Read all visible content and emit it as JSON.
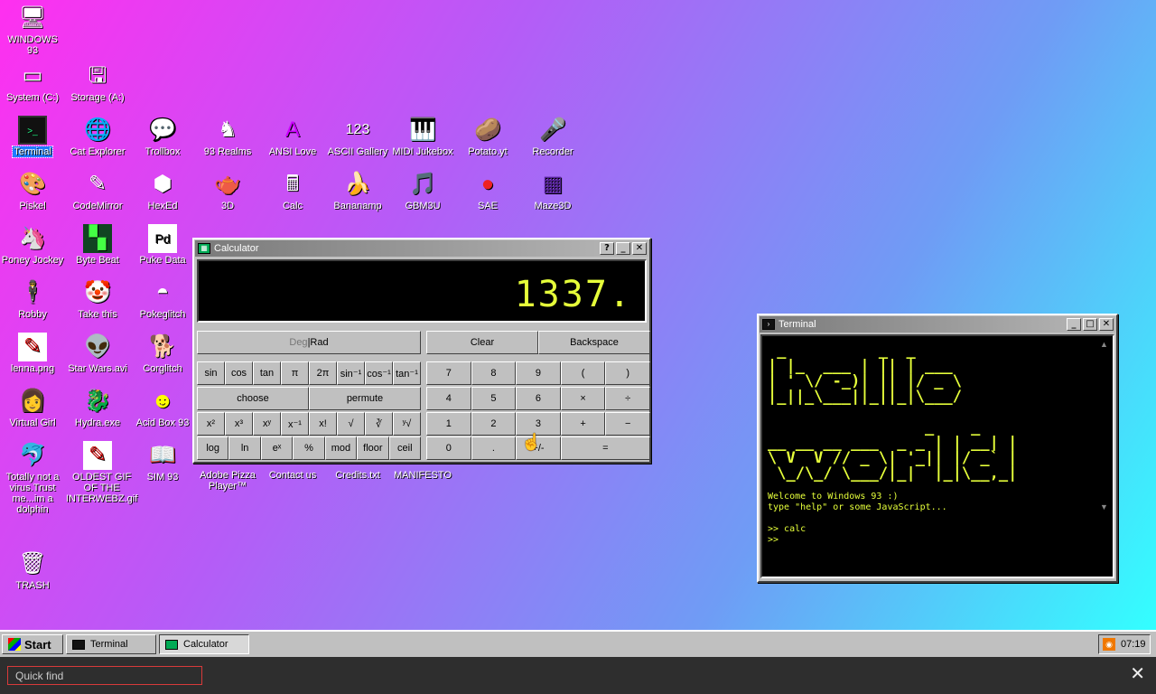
{
  "desktop": {
    "icons": [
      {
        "label": "WINDOWS 93",
        "icon": "computer-icon"
      },
      {
        "label": "System (C:)",
        "icon": "drive-icon"
      },
      {
        "label": "Storage (A:)",
        "icon": "floppy-icon"
      },
      {
        "label": "Terminal",
        "icon": "terminal-icon",
        "selected": true
      },
      {
        "label": "Cat Explorer",
        "icon": "cat-globe-icon"
      },
      {
        "label": "Trollbox",
        "icon": "chat-icon"
      },
      {
        "label": "93 Realms",
        "icon": "realms-icon"
      },
      {
        "label": "ANSI Love",
        "icon": "ansi-icon"
      },
      {
        "label": "ASCII Gallery",
        "icon": "ascii-icon"
      },
      {
        "label": "MIDI Jukebox",
        "icon": "piano-icon"
      },
      {
        "label": "Potato.yt",
        "icon": "potato-icon"
      },
      {
        "label": "Recorder",
        "icon": "microphone-icon"
      },
      {
        "label": "Piskel",
        "icon": "palette-icon"
      },
      {
        "label": "CodeMirror",
        "icon": "codemirror-icon"
      },
      {
        "label": "HexEd",
        "icon": "cube-icon"
      },
      {
        "label": "3D",
        "icon": "teapot-icon"
      },
      {
        "label": "Calc",
        "icon": "calculator-icon"
      },
      {
        "label": "Bananamp",
        "icon": "banana-icon"
      },
      {
        "label": "GBM3U",
        "icon": "music-file-icon"
      },
      {
        "label": "SAE",
        "icon": "ball-icon"
      },
      {
        "label": "Maze3D",
        "icon": "maze-icon"
      },
      {
        "label": "Poney Jockey",
        "icon": "pony-icon"
      },
      {
        "label": "Byte Beat",
        "icon": "bytebeat-icon"
      },
      {
        "label": "Puke Data",
        "icon": "puredata-icon"
      },
      {
        "label": "Robby",
        "icon": "robot-icon"
      },
      {
        "label": "Take this",
        "icon": "clown-icon"
      },
      {
        "label": "Pokeglitch",
        "icon": "pokeball-icon"
      },
      {
        "label": "lenna.png",
        "icon": "image-icon"
      },
      {
        "label": "Star Wars.avi",
        "icon": "yoda-icon"
      },
      {
        "label": "Corglitch",
        "icon": "corgi-icon"
      },
      {
        "label": "Virtual Girl",
        "icon": "girl-icon"
      },
      {
        "label": "Hydra.exe",
        "icon": "hydra-icon"
      },
      {
        "label": "Acid Box 93",
        "icon": "smiley-icon"
      },
      {
        "label": "Totally not a virus.Trust me...im a dolphin",
        "icon": "dolphin-icon"
      },
      {
        "label": "OLDEST GIF OF THE INTERWEBZ.gif",
        "icon": "gif-icon"
      },
      {
        "label": "SIM 93",
        "icon": "sim-icon"
      },
      {
        "label": "Adobe Pizza Player™",
        "icon": "pizza-icon"
      },
      {
        "label": "Contact us",
        "icon": "contact-icon"
      },
      {
        "label": "Credits.txt",
        "icon": "text-file-icon"
      },
      {
        "label": "MANIFESTO",
        "icon": "manifesto-icon"
      },
      {
        "label": "TRASH",
        "icon": "trash-icon"
      }
    ]
  },
  "calculator": {
    "title": "Calculator",
    "display": "1337.",
    "mode_label_deg": "Deg",
    "mode_label_sep": " | ",
    "mode_label_rad": "Rad",
    "clear_label": "Clear",
    "backspace_label": "Backspace",
    "sci_row1": [
      "sin",
      "cos",
      "tan",
      "π",
      "2π",
      "sin⁻¹",
      "cos⁻¹",
      "tan⁻¹"
    ],
    "choose_label": "choose",
    "permute_label": "permute",
    "sci_row3": [
      "x²",
      "x³",
      "xʸ",
      "x⁻¹",
      "x!",
      "√",
      "∛",
      "ʸ√"
    ],
    "sci_row4": [
      "log",
      "ln",
      "eˣ",
      "%",
      "mod",
      "floor",
      "ceil"
    ],
    "num_row1": [
      "7",
      "8",
      "9",
      "(",
      ")"
    ],
    "num_row2": [
      "4",
      "5",
      "6",
      "×",
      "÷"
    ],
    "num_row3": [
      "1",
      "2",
      "3",
      "+",
      "−"
    ],
    "num_row4": [
      "0",
      ".",
      "+/-",
      "="
    ]
  },
  "terminal": {
    "title": "Terminal",
    "ascii_art": " _          _  _\n| |_  ___ | || | ___\n| ' \\/ -_)| || |/ _ \\\n|_||_\\___||_||_|\\___/\n\n                 _    _\n__ __ __ ___  _ _ | | __| |\n\\ V  V // _ \\| '_|| |/ _` |\n \\_/\\_/ \\___/|_|  |_|\\__,_|",
    "lines": [
      "Welcome to Windows 93 :)",
      "type \"help\" or some JavaScript...",
      "",
      ">> calc",
      ">>"
    ]
  },
  "taskbar": {
    "start_label": "Start",
    "tasks": [
      {
        "label": "Terminal",
        "pressed": false
      },
      {
        "label": "Calculator",
        "pressed": true
      }
    ],
    "clock": "07:19",
    "tray_icon": "rss-icon"
  },
  "quickfind": {
    "placeholder": "Quick find",
    "value": ""
  }
}
